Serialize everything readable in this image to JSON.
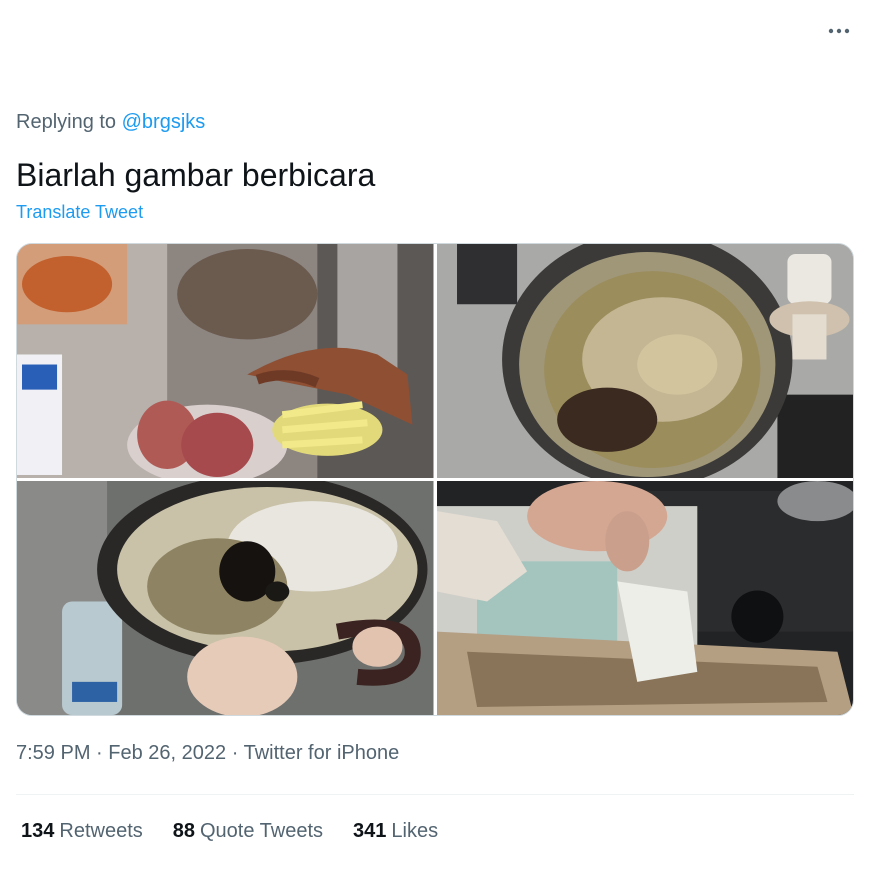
{
  "header": {
    "more_icon": "more-horizontal-icon"
  },
  "tweet": {
    "replying_prefix": "Replying to",
    "replying_handle": "@brgsjks",
    "text": "Biarlah gambar berbicara",
    "translate_label": "Translate Tweet",
    "time": "7:59 PM",
    "date": "Feb 26, 2022",
    "source": "Twitter for iPhone",
    "separator": "·"
  },
  "media": {
    "photos": [
      {
        "name": "fridge-vegetables-photo"
      },
      {
        "name": "dirty-pot-photo"
      },
      {
        "name": "burnt-wok-photo"
      },
      {
        "name": "stove-foil-photo"
      }
    ]
  },
  "stats": {
    "retweets_count": "134",
    "retweets_label": "Retweets",
    "quotes_count": "88",
    "quotes_label": "Quote Tweets",
    "likes_count": "341",
    "likes_label": "Likes"
  },
  "colors": {
    "accent": "#1d9bf0",
    "secondary_text": "#536471",
    "primary_text": "#0f1419"
  }
}
